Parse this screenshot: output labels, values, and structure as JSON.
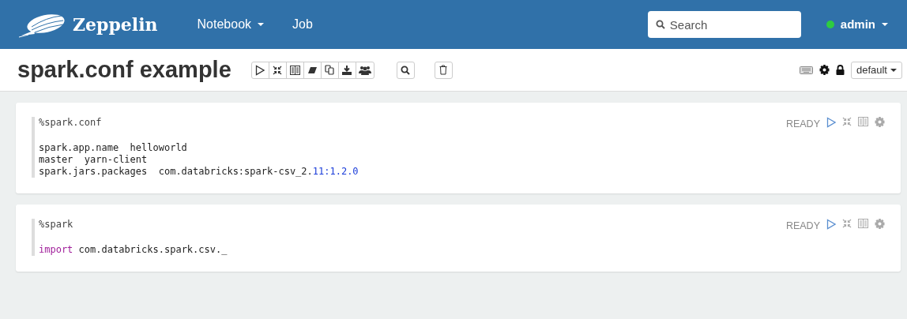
{
  "navbar": {
    "brand": "Zeppelin",
    "menus": [
      {
        "label": "Notebook",
        "dropdown": true
      },
      {
        "label": "Job",
        "dropdown": false
      }
    ],
    "search": {
      "placeholder": "Search"
    },
    "user": {
      "name": "admin",
      "online": true
    }
  },
  "note": {
    "title": "spark.conf example",
    "interpreter_binding": "default"
  },
  "paragraphs": [
    {
      "interpreter": "%spark.conf",
      "status": "READY",
      "code": [
        [
          {
            "kind": "plain",
            "text": "spark.app.name  helloworld"
          }
        ],
        [
          {
            "kind": "plain",
            "text": "master  yarn-client"
          }
        ],
        [
          {
            "kind": "plain",
            "text": "spark.jars.packages  com.databricks:spark-csv_2."
          },
          {
            "kind": "number",
            "text": "11:1.2.0"
          }
        ]
      ]
    },
    {
      "interpreter": "%spark",
      "status": "READY",
      "code": [
        [
          {
            "kind": "keyword",
            "text": "import"
          },
          {
            "kind": "plain",
            "text": " com.databricks.spark.csv._"
          }
        ]
      ]
    }
  ]
}
